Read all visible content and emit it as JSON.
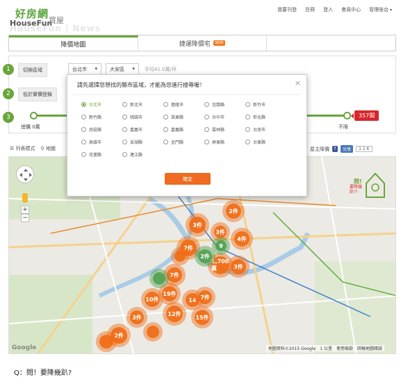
{
  "header": {
    "logo_main": "好房網",
    "logo_sub": "HouseFun",
    "logo_cn": "買屋",
    "logo_watermark": "HouseFun | News",
    "nav": [
      "我要刊登",
      "註冊",
      "登入",
      "會員中心",
      "管理後台"
    ]
  },
  "tabs": [
    {
      "label": "降價地圖",
      "active": true
    },
    {
      "label": "捷運降價宅",
      "badge": "NEW"
    },
    {
      "label": ""
    }
  ],
  "filters": {
    "step1": {
      "num": "1",
      "label": "切換區域",
      "city": "台北市",
      "district": "大安區",
      "avg": "平均41.0萬/坪"
    },
    "step2": {
      "num": "2",
      "label": "低於實價登錄"
    },
    "step3": {
      "num": "3",
      "min_label": "總價 0萬",
      "max_label": "不限",
      "count": "357間"
    }
  },
  "toolbar": {
    "list_mode": "列表模式",
    "map_label": "地圖",
    "zoom_hint": "屋主降價",
    "fb": "f",
    "share": "分享",
    "share_count": "1.1 K"
  },
  "map": {
    "google": "Google",
    "credit": [
      "地圖資料©2015 Google",
      "1 公里",
      "使用條款",
      "回報地圖錯誤"
    ],
    "badge_line1": "問!",
    "badge_line2": "要降幾趴?!",
    "clusters": [
      {
        "label": "2件",
        "color": "orange"
      },
      {
        "label": "3件",
        "color": "orange"
      },
      {
        "label": "4件",
        "color": "orange"
      },
      {
        "label": "3件",
        "color": "orange"
      },
      {
        "label": "7件",
        "color": "orange"
      },
      {
        "label": "1,700萬",
        "color": "orange"
      },
      {
        "label": "3件",
        "color": "orange"
      },
      {
        "label": "2件",
        "color": "green"
      },
      {
        "label": "7件",
        "color": "orange"
      },
      {
        "label": "9",
        "color": "green"
      },
      {
        "label": "19件",
        "color": "orange"
      },
      {
        "label": "14",
        "color": "orange"
      },
      {
        "label": "7件",
        "color": "orange"
      },
      {
        "label": "10件",
        "color": "orange"
      },
      {
        "label": "3件",
        "color": "orange"
      },
      {
        "label": "12件",
        "color": "orange"
      },
      {
        "label": "15件",
        "color": "orange"
      },
      {
        "label": "2件",
        "color": "orange"
      },
      {
        "label": "",
        "color": "orange"
      },
      {
        "label": "",
        "color": "green"
      },
      {
        "label": "",
        "color": "orange"
      },
      {
        "label": "",
        "color": "orange"
      }
    ]
  },
  "modal": {
    "title": "請先選擇您想找的縣市區域，才能為您進行搜尋喔！",
    "cities": [
      "台北市",
      "新北市",
      "基隆市",
      "宜蘭縣",
      "新竹市",
      "新竹縣",
      "桃園市",
      "苗栗縣",
      "台中市",
      "彰化縣",
      "南投縣",
      "嘉義市",
      "嘉義縣",
      "雲林縣",
      "台南市",
      "高雄市",
      "澎湖縣",
      "金門縣",
      "屏東縣",
      "台東縣",
      "花蓮縣",
      "連江縣"
    ],
    "selected": "台北市",
    "ok": "確定",
    "close": "×"
  },
  "caption": "Q：問！要降幾趴?",
  "colors": {
    "accent": "#6aa53b",
    "orange": "#ef6b22",
    "badge_red": "#d7262b"
  }
}
